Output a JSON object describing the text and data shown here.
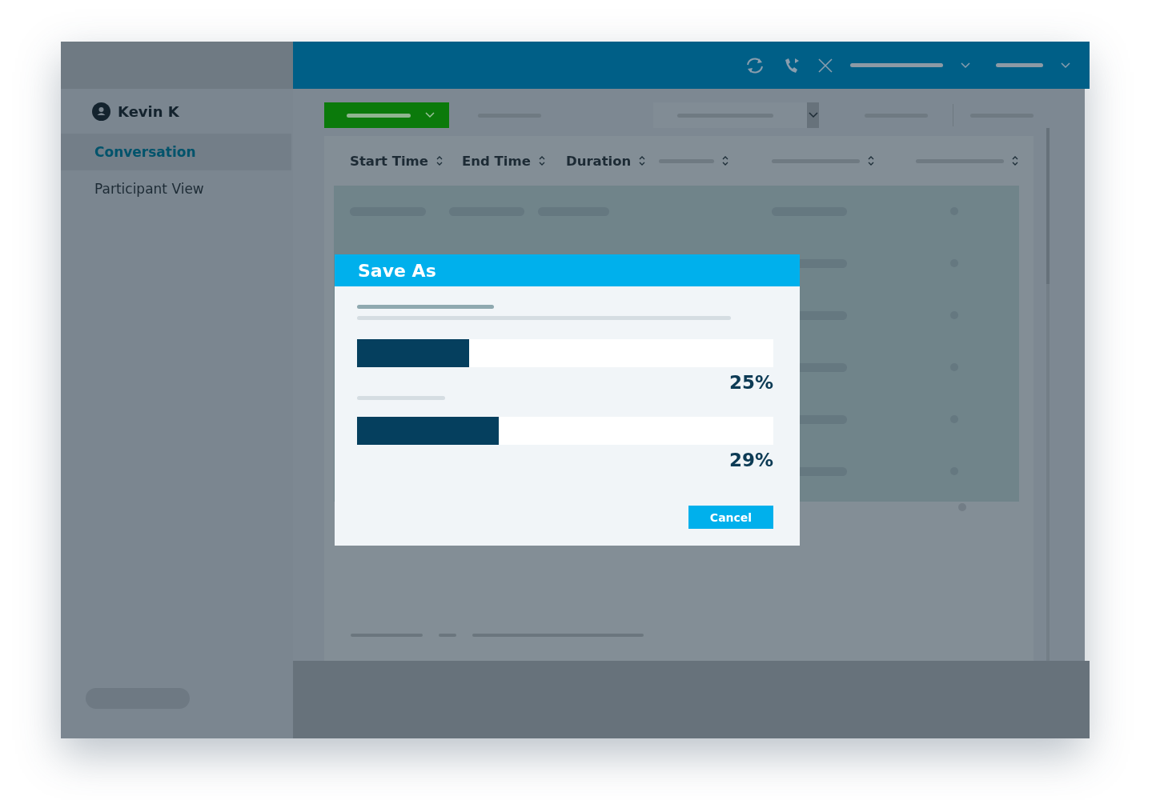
{
  "sidebar": {
    "user": "Kevin K",
    "items": [
      {
        "label": "Conversation",
        "selected": true
      },
      {
        "label": "Participant View",
        "selected": false
      }
    ]
  },
  "table": {
    "columns": [
      "Start Time",
      "End Time",
      "Duration"
    ]
  },
  "dialog": {
    "title": "Save As",
    "progress": [
      {
        "level": 0.27,
        "reading": "25%"
      },
      {
        "level": 0.34,
        "reading": "29%"
      }
    ],
    "buttons": [
      "Cancel"
    ]
  }
}
